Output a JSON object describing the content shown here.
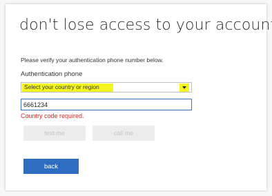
{
  "page": {
    "title": "don't lose access to your account!",
    "intro": "Please verify your authentication phone number below."
  },
  "form": {
    "phone_label": "Authentication phone",
    "country_select": {
      "selected_value": "Select your country or region"
    },
    "phone_input": {
      "value": "6661234"
    },
    "error_message": "Country code required."
  },
  "buttons": {
    "text_me": "text me",
    "call_me": "call me",
    "back": "back"
  },
  "colors": {
    "accent": "#2e6ec1",
    "error": "#d4281e",
    "highlight": "#f4f41f"
  },
  "icons": {
    "select_arrow": "dropdown-arrow-icon"
  }
}
